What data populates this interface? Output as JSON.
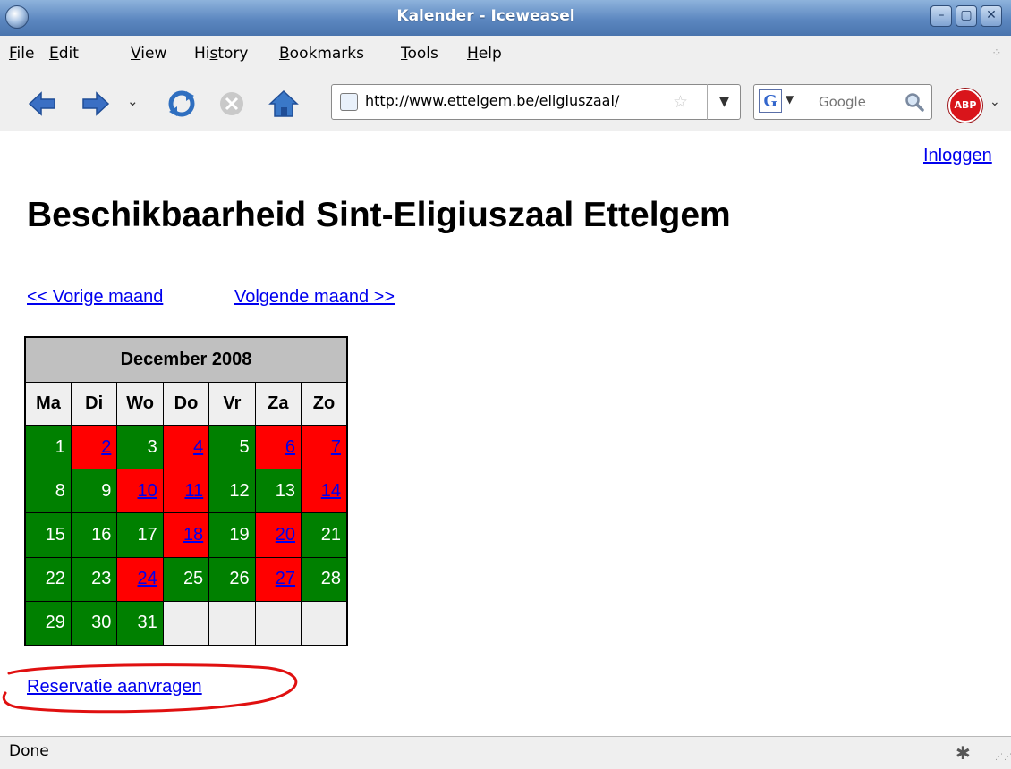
{
  "window": {
    "title": "Kalender - Iceweasel"
  },
  "menu": {
    "items": [
      {
        "mnemonic": "F",
        "rest": "ile"
      },
      {
        "mnemonic": "E",
        "rest": "dit"
      },
      {
        "mnemonic": "V",
        "rest": "iew"
      },
      {
        "pre": "Hi",
        "mnemonic": "s",
        "rest": "tory"
      },
      {
        "mnemonic": "B",
        "rest": "ookmarks"
      },
      {
        "mnemonic": "T",
        "rest": "ools"
      },
      {
        "mnemonic": "H",
        "rest": "elp"
      }
    ]
  },
  "toolbar": {
    "url": "http://www.ettelgem.be/eligiuszaal/",
    "search_placeholder": "Google",
    "abp_label": "ABP"
  },
  "page": {
    "login_link": "Inloggen",
    "title": "Beschikbaarheid Sint-Eligiuszaal Ettelgem",
    "prev_month": "<< Vorige maand",
    "next_month": "Volgende maand >>",
    "calendar": {
      "month": "December 2008",
      "weekdays": [
        "Ma",
        "Di",
        "Wo",
        "Do",
        "Vr",
        "Za",
        "Zo"
      ],
      "weeks": [
        [
          {
            "day": "1",
            "status": "free"
          },
          {
            "day": "2",
            "status": "busy"
          },
          {
            "day": "3",
            "status": "free"
          },
          {
            "day": "4",
            "status": "busy"
          },
          {
            "day": "5",
            "status": "free"
          },
          {
            "day": "6",
            "status": "busy"
          },
          {
            "day": "7",
            "status": "busy"
          }
        ],
        [
          {
            "day": "8",
            "status": "free"
          },
          {
            "day": "9",
            "status": "free"
          },
          {
            "day": "10",
            "status": "busy"
          },
          {
            "day": "11",
            "status": "busy"
          },
          {
            "day": "12",
            "status": "free"
          },
          {
            "day": "13",
            "status": "free"
          },
          {
            "day": "14",
            "status": "busy"
          }
        ],
        [
          {
            "day": "15",
            "status": "free"
          },
          {
            "day": "16",
            "status": "free"
          },
          {
            "day": "17",
            "status": "free"
          },
          {
            "day": "18",
            "status": "busy"
          },
          {
            "day": "19",
            "status": "free"
          },
          {
            "day": "20",
            "status": "busy"
          },
          {
            "day": "21",
            "status": "free"
          }
        ],
        [
          {
            "day": "22",
            "status": "free"
          },
          {
            "day": "23",
            "status": "free"
          },
          {
            "day": "24",
            "status": "busy"
          },
          {
            "day": "25",
            "status": "free"
          },
          {
            "day": "26",
            "status": "free"
          },
          {
            "day": "27",
            "status": "busy"
          },
          {
            "day": "28",
            "status": "free"
          }
        ],
        [
          {
            "day": "29",
            "status": "free"
          },
          {
            "day": "30",
            "status": "free"
          },
          {
            "day": "31",
            "status": "free"
          },
          {
            "day": "",
            "status": "empty"
          },
          {
            "day": "",
            "status": "empty"
          },
          {
            "day": "",
            "status": "empty"
          },
          {
            "day": "",
            "status": "empty"
          }
        ]
      ]
    },
    "reserve_link": "Reservatie aanvragen"
  },
  "status": {
    "text": "Done"
  },
  "colors": {
    "free": "#008000",
    "busy": "#ff0000",
    "empty": "#eeeeee",
    "link": "#0000ee",
    "annotation": "#e01010"
  },
  "icons": {
    "back": "back-arrow-icon",
    "forward": "forward-arrow-icon",
    "reload": "reload-icon",
    "stop": "stop-icon",
    "home": "home-icon",
    "bookmark_star": "star-icon",
    "search_go": "magnifier-icon",
    "adblock": "adblock-plus-icon",
    "status": "bug-icon"
  }
}
